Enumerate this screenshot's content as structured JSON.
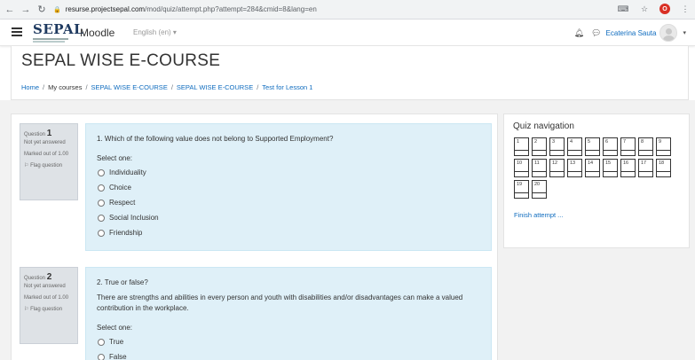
{
  "browser": {
    "url_host": "resurse.projectsepal.com",
    "url_path": "/mod/quiz/attempt.php?attempt=284&cmid=8&lang=en"
  },
  "navbar": {
    "logo_text": "SEPAL",
    "site_name": "Moodle",
    "language": "English (en) ▾",
    "username": "Ecaterina Sauta"
  },
  "header": {
    "course_title": "SEPAL WISE E-COURSE",
    "breadcrumb": [
      "Home",
      "My courses",
      "SEPAL WISE E-COURSE",
      "SEPAL WISE E-COURSE",
      "Test for Lesson 1"
    ]
  },
  "questions": [
    {
      "label": "Question",
      "number": "1",
      "state": "Not yet answered",
      "grade": "Marked out of 1.00",
      "flag": "Flag question",
      "text": "1. Which of the following value does not belong to Supported Employment?",
      "prompt": "Select one:",
      "answers": [
        "Individuality",
        "Choice",
        "Respect",
        "Social Inclusion",
        "Friendship"
      ]
    },
    {
      "label": "Question",
      "number": "2",
      "state": "Not yet answered",
      "grade": "Marked out of 1.00",
      "flag": "Flag question",
      "text": "2. True or false?",
      "text2": "There are strengths and abilities in every person and youth with disabilities and/or disadvantages can make a valued contribution in the workplace.",
      "prompt": "Select one:",
      "answers": [
        "True",
        "False"
      ]
    }
  ],
  "quiz_nav": {
    "title": "Quiz navigation",
    "buttons": [
      "1",
      "2",
      "3",
      "4",
      "5",
      "6",
      "7",
      "8",
      "9",
      "10",
      "11",
      "12",
      "13",
      "14",
      "15",
      "16",
      "17",
      "18",
      "19",
      "20"
    ],
    "finish": "Finish attempt ..."
  }
}
